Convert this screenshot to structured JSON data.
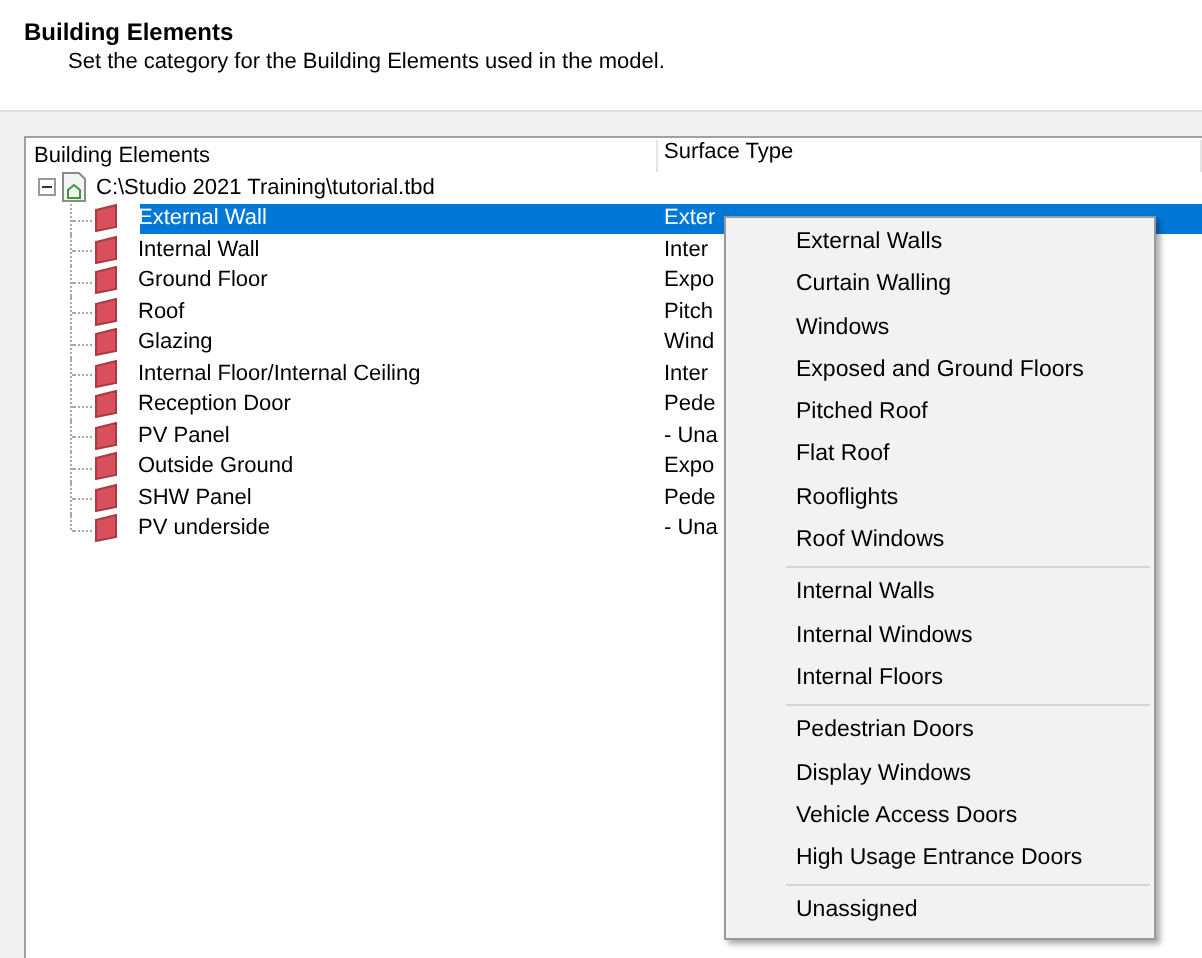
{
  "header": {
    "title": "Building Elements",
    "subtitle": "Set the category for the Building Elements used in the model."
  },
  "list": {
    "columns": [
      "Building Elements",
      "Surface Type"
    ],
    "root": {
      "label": "C:\\Studio 2021 Training\\tutorial.tbd",
      "expanded": true,
      "children": [
        {
          "label": "External Wall",
          "surface": "Exter",
          "selected": true
        },
        {
          "label": "Internal Wall",
          "surface": "Inter",
          "selected": false
        },
        {
          "label": "Ground Floor",
          "surface": "Expo",
          "selected": false
        },
        {
          "label": "Roof",
          "surface": "Pitch",
          "selected": false
        },
        {
          "label": "Glazing",
          "surface": "Wind",
          "selected": false
        },
        {
          "label": "Internal Floor/Internal Ceiling",
          "surface": "Inter",
          "selected": false
        },
        {
          "label": "Reception Door",
          "surface": "Pede",
          "selected": false
        },
        {
          "label": "PV Panel",
          "surface": "- Una",
          "selected": false
        },
        {
          "label": "Outside Ground",
          "surface": "Expo",
          "selected": false
        },
        {
          "label": "SHW Panel",
          "surface": "Pede",
          "selected": false
        },
        {
          "label": "PV underside",
          "surface": "- Una",
          "selected": false
        }
      ]
    }
  },
  "context_menu": {
    "groups": [
      [
        "External Walls",
        "Curtain Walling",
        "Windows",
        "Exposed and Ground Floors",
        "Pitched Roof",
        "Flat Roof",
        "Rooflights",
        "Roof Windows"
      ],
      [
        "Internal Walls",
        "Internal Windows",
        "Internal Floors"
      ],
      [
        "Pedestrian Doors",
        "Display Windows",
        "Vehicle Access Doors",
        "High Usage Entrance Doors"
      ],
      [
        "Unassigned"
      ]
    ]
  }
}
